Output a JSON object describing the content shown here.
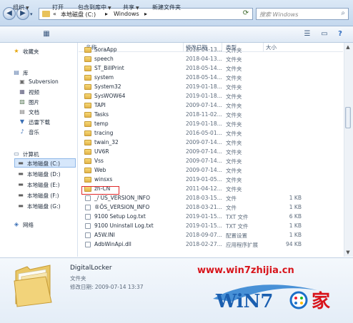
{
  "address": {
    "crumbs": [
      "«",
      "本地磁盘 (C:)",
      "▸",
      "Windows",
      "▸"
    ],
    "search_placeholder": "搜索 Windows"
  },
  "toolbar": {
    "organize": "组织",
    "open": "打开",
    "include_in_library": "包含到库中",
    "share": "共享",
    "new_folder": "新建文件夹"
  },
  "nav": {
    "favorites": "收藏夹",
    "libraries": "库",
    "lib_items": [
      "Subversion",
      "视频",
      "图片",
      "文档",
      "迅雷下载",
      "音乐"
    ],
    "computer": "计算机",
    "drives": [
      "本地磁盘 (C:)",
      "本地磁盘 (D:)",
      "本地磁盘 (E:)",
      "本地磁盘 (F:)",
      "本地磁盘 (G:)"
    ],
    "network": "网络"
  },
  "columns": {
    "name": "名称",
    "modified": "修改日期",
    "type": "类型",
    "size": "大小"
  },
  "files": [
    {
      "name": "SoraApp",
      "date": "2018-04-13...",
      "type": "文件夹",
      "size": "",
      "kind": "folder"
    },
    {
      "name": "speech",
      "date": "2018-04-13...",
      "type": "文件夹",
      "size": "",
      "kind": "folder"
    },
    {
      "name": "ST_BillPrint",
      "date": "2018-05-14...",
      "type": "文件夹",
      "size": "",
      "kind": "folder"
    },
    {
      "name": "system",
      "date": "2018-05-14...",
      "type": "文件夹",
      "size": "",
      "kind": "folder"
    },
    {
      "name": "System32",
      "date": "2019-01-18...",
      "type": "文件夹",
      "size": "",
      "kind": "folder"
    },
    {
      "name": "SysWOW64",
      "date": "2019-01-18...",
      "type": "文件夹",
      "size": "",
      "kind": "folder"
    },
    {
      "name": "TAPI",
      "date": "2009-07-14...",
      "type": "文件夹",
      "size": "",
      "kind": "folder"
    },
    {
      "name": "Tasks",
      "date": "2018-11-02...",
      "type": "文件夹",
      "size": "",
      "kind": "folder"
    },
    {
      "name": "temp",
      "date": "2019-01-18...",
      "type": "文件夹",
      "size": "",
      "kind": "folder"
    },
    {
      "name": "tracing",
      "date": "2016-05-01...",
      "type": "文件夹",
      "size": "",
      "kind": "folder"
    },
    {
      "name": "twain_32",
      "date": "2009-07-14...",
      "type": "文件夹",
      "size": "",
      "kind": "folder"
    },
    {
      "name": "UV6R",
      "date": "2009-07-14...",
      "type": "文件夹",
      "size": "",
      "kind": "folder"
    },
    {
      "name": "Vss",
      "date": "2009-07-14...",
      "type": "文件夹",
      "size": "",
      "kind": "folder"
    },
    {
      "name": "Web",
      "date": "2009-07-14...",
      "type": "文件夹",
      "size": "",
      "kind": "folder"
    },
    {
      "name": "winsxs",
      "date": "2019-01-05...",
      "type": "文件夹",
      "size": "",
      "kind": "folder"
    },
    {
      "name": "zh-CN",
      "date": "2011-04-12...",
      "type": "文件夹",
      "size": "",
      "kind": "folder"
    },
    {
      "name": "_/ ÚS_VERSION_INFO",
      "date": "2018-03-15...",
      "type": "文件",
      "size": "1 KB",
      "kind": "file"
    },
    {
      "name": "®ÕS_VERSION_INFO",
      "date": "2018-03-21...",
      "type": "文件",
      "size": "1 KB",
      "kind": "file"
    },
    {
      "name": "9100 Setup Log.txt",
      "date": "2019-01-15...",
      "type": "TXT 文件",
      "size": "6 KB",
      "kind": "file"
    },
    {
      "name": "9100 Uninstall Log.txt",
      "date": "2019-01-15...",
      "type": "TXT 文件",
      "size": "1 KB",
      "kind": "file"
    },
    {
      "name": "A5W.INI",
      "date": "2018-09-07...",
      "type": "配置设置",
      "size": "1 KB",
      "kind": "file"
    },
    {
      "name": "AdbWinApi.dll",
      "date": "2018-02-27...",
      "type": "应用程序扩展",
      "size": "94 KB",
      "kind": "file"
    }
  ],
  "details": {
    "name": "DigitalLocker",
    "type": "文件夹",
    "modified": "修改日期: 2009-07-14 13:37"
  },
  "watermark": {
    "url": "www.win7zhijia.cn",
    "logo_text": "WiN7",
    "logo_suffix": "家"
  }
}
